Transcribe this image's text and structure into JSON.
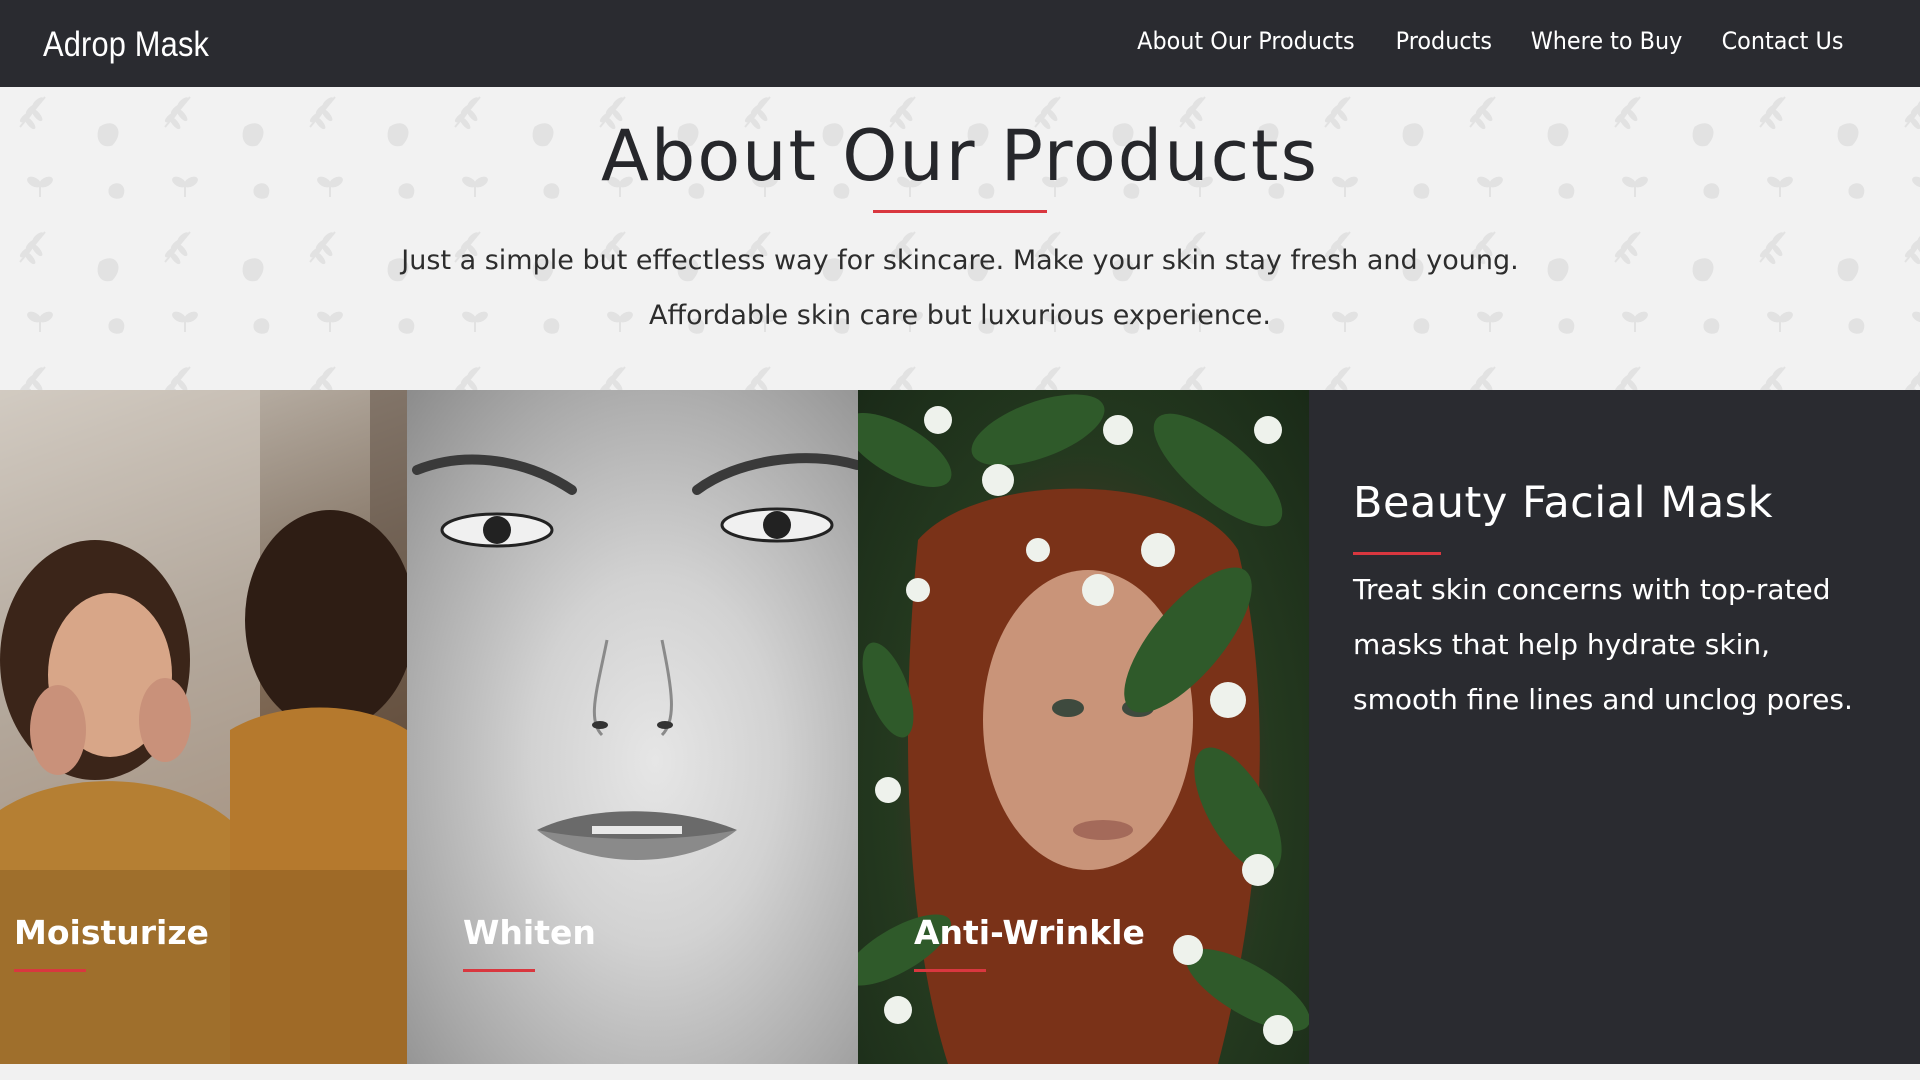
{
  "navbar": {
    "brand": "Adrop Mask",
    "links": [
      {
        "label": "About Our Products"
      },
      {
        "label": "Products"
      },
      {
        "label": "Where to Buy"
      },
      {
        "label": "Contact Us"
      }
    ]
  },
  "hero": {
    "title": "About Our Products",
    "line1": "Just a simple but effectless way for skincare. Make your skin stay fresh and young.",
    "line2": "Affordable skin care but luxurious experience."
  },
  "features": {
    "panels": [
      {
        "label": "Moisturize"
      },
      {
        "label": "Whiten"
      },
      {
        "label": "Anti-Wrinkle"
      }
    ],
    "info": {
      "title": "Beauty Facial Mask",
      "lines": [
        "Treat skin concerns with top-rated",
        "masks that help hydrate skin,",
        "smooth fine lines and unclog pores."
      ]
    }
  },
  "colors": {
    "dark": "#2a2b30",
    "accent": "#d9373f",
    "hero_bg": "#f2f2f2"
  },
  "icons": [
    "leaf-pattern"
  ]
}
